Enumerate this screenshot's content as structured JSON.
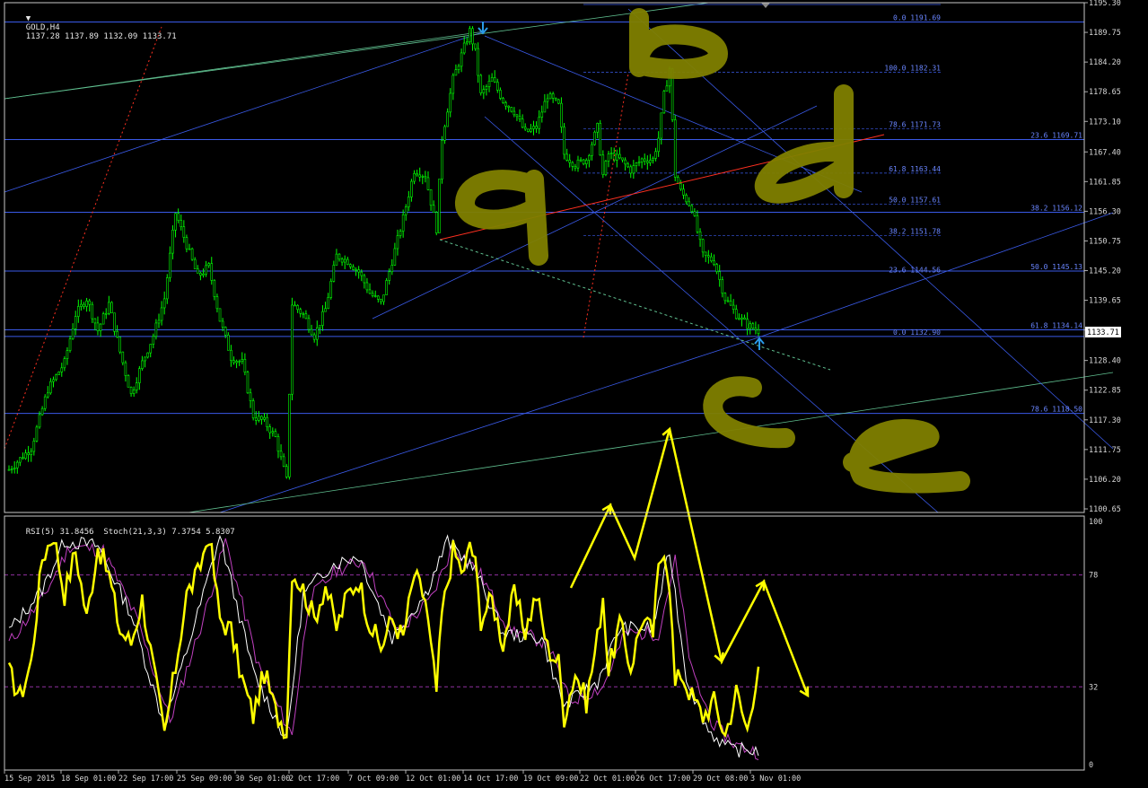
{
  "header": {
    "symbol": "GOLD,H4",
    "ohlc": "1137.28 1137.89 1132.09 1133.71",
    "indicator": "RSI(5) 31.8456  Stoch(21,3,3) 7.3754 5.8307"
  },
  "colors": {
    "background": "#000000",
    "candle": "#00ff00",
    "grid_line": "#3a5ae8",
    "fib_text": "#6a86ff",
    "rsi": "#ffff00",
    "stoch_main": "#ffffff",
    "stoch_signal": "#c040c0",
    "annotation": "#808000",
    "arrow": "#ffff00",
    "green_line": "#60c090",
    "red_line": "#ff3020",
    "marker": "#2a9ae8"
  },
  "chart_data": [
    {
      "type": "candlestick",
      "symbol": "GOLD",
      "timeframe": "H4",
      "ylim": [
        1100.65,
        1195.3
      ],
      "y_ticks": [
        "1195.30",
        "1189.75",
        "1184.20",
        "1178.65",
        "1173.10",
        "1167.40",
        "1161.85",
        "1156.30",
        "1150.75",
        "1145.20",
        "1139.65",
        "1134.10",
        "1128.40",
        "1122.85",
        "1117.30",
        "1111.75",
        "1106.20",
        "1100.65"
      ],
      "current_price": "1133.71",
      "x_ticks": [
        "15 Sep 2015",
        "18 Sep 01:00",
        "22 Sep 17:00",
        "25 Sep 09:00",
        "30 Sep 01:00",
        "2 Oct 17:00",
        "7 Oct 09:00",
        "12 Oct 01:00",
        "14 Oct 17:00",
        "19 Oct 09:00",
        "22 Oct 01:00",
        "26 Oct 17:00",
        "29 Oct 08:00",
        "3 Nov 01:00"
      ],
      "close_path": [
        [
          0,
          1108
        ],
        [
          4,
          1112
        ],
        [
          7,
          1123
        ],
        [
          10,
          1128
        ],
        [
          12,
          1137
        ],
        [
          14,
          1140
        ],
        [
          16,
          1134
        ],
        [
          18,
          1139
        ],
        [
          20,
          1130
        ],
        [
          22,
          1122
        ],
        [
          24,
          1128
        ],
        [
          26,
          1133
        ],
        [
          28,
          1140
        ],
        [
          30,
          1156
        ],
        [
          32,
          1150
        ],
        [
          34,
          1144
        ],
        [
          36,
          1146
        ],
        [
          38,
          1136
        ],
        [
          40,
          1129
        ],
        [
          42,
          1128
        ],
        [
          44,
          1118
        ],
        [
          46,
          1117
        ],
        [
          48,
          1114
        ],
        [
          50,
          1106
        ],
        [
          51,
          1139
        ],
        [
          53,
          1137
        ],
        [
          55,
          1133
        ],
        [
          57,
          1138
        ],
        [
          59,
          1148
        ],
        [
          61,
          1147
        ],
        [
          63,
          1145
        ],
        [
          65,
          1141
        ],
        [
          67,
          1139
        ],
        [
          69,
          1147
        ],
        [
          71,
          1155
        ],
        [
          73,
          1164
        ],
        [
          75,
          1163
        ],
        [
          76,
          1158
        ],
        [
          77,
          1153
        ],
        [
          78,
          1170
        ],
        [
          80,
          1181
        ],
        [
          82,
          1187
        ],
        [
          83,
          1190
        ],
        [
          84,
          1186
        ],
        [
          85,
          1178
        ],
        [
          87,
          1181
        ],
        [
          89,
          1177
        ],
        [
          91,
          1175
        ],
        [
          93,
          1171
        ],
        [
          95,
          1172
        ],
        [
          97,
          1178
        ],
        [
          99,
          1176
        ],
        [
          100,
          1167
        ],
        [
          102,
          1165
        ],
        [
          104,
          1166
        ],
        [
          106,
          1172
        ],
        [
          107,
          1163
        ],
        [
          108,
          1167
        ],
        [
          110,
          1166
        ],
        [
          112,
          1164
        ],
        [
          114,
          1166
        ],
        [
          116,
          1166
        ],
        [
          117,
          1170
        ],
        [
          118,
          1178
        ],
        [
          119,
          1183
        ],
        [
          120,
          1163
        ],
        [
          121,
          1160
        ],
        [
          123,
          1157
        ],
        [
          125,
          1148
        ],
        [
          127,
          1147
        ],
        [
          129,
          1140
        ],
        [
          131,
          1137
        ],
        [
          133,
          1135
        ],
        [
          135,
          1134
        ]
      ],
      "fib_levels_left": [
        {
          "level": "0.0",
          "price": "1191.69"
        },
        {
          "level": "100.0",
          "price": "1182.31"
        },
        {
          "level": "78.6",
          "price": "1171.73"
        },
        {
          "level": "61.8",
          "price": "1163.44"
        },
        {
          "level": "50.0",
          "price": "1157.61"
        },
        {
          "level": "38.2",
          "price": "1151.78"
        },
        {
          "level": "23.6",
          "price": "1144.56"
        },
        {
          "level": "0.0",
          "price": "1132.90"
        }
      ],
      "fib_levels_right": [
        {
          "level": "23.6",
          "price": "1169.71"
        },
        {
          "level": "38.2",
          "price": "1156.12"
        },
        {
          "level": "50.0",
          "price": "1145.13"
        },
        {
          "level": "61.8",
          "price": "1134.14"
        },
        {
          "level": "78.6",
          "price": "1118.50"
        }
      ],
      "annotations": [
        "a",
        "b",
        "d",
        "c",
        "e"
      ]
    },
    {
      "type": "line",
      "title": "RSI(5) 31.8456  Stoch(21,3,3) 7.3754 5.8307",
      "ylim": [
        0,
        100
      ],
      "y_ticks": [
        "100",
        "78",
        "32",
        "0"
      ],
      "levels": [
        78,
        32
      ],
      "rsi_path": [
        [
          0,
          38
        ],
        [
          2,
          28
        ],
        [
          4,
          42
        ],
        [
          6,
          85
        ],
        [
          8,
          95
        ],
        [
          10,
          70
        ],
        [
          12,
          88
        ],
        [
          14,
          60
        ],
        [
          16,
          90
        ],
        [
          18,
          78
        ],
        [
          20,
          55
        ],
        [
          22,
          50
        ],
        [
          24,
          68
        ],
        [
          26,
          40
        ],
        [
          28,
          12
        ],
        [
          30,
          40
        ],
        [
          32,
          70
        ],
        [
          34,
          78
        ],
        [
          36,
          95
        ],
        [
          38,
          60
        ],
        [
          40,
          55
        ],
        [
          42,
          35
        ],
        [
          44,
          20
        ],
        [
          46,
          38
        ],
        [
          48,
          22
        ],
        [
          50,
          14
        ],
        [
          51,
          80
        ],
        [
          53,
          72
        ],
        [
          55,
          60
        ],
        [
          57,
          74
        ],
        [
          59,
          56
        ],
        [
          61,
          70
        ],
        [
          63,
          76
        ],
        [
          65,
          58
        ],
        [
          67,
          48
        ],
        [
          69,
          60
        ],
        [
          71,
          52
        ],
        [
          73,
          78
        ],
        [
          75,
          68
        ],
        [
          76,
          48
        ],
        [
          77,
          30
        ],
        [
          78,
          62
        ],
        [
          80,
          88
        ],
        [
          82,
          78
        ],
        [
          83,
          92
        ],
        [
          84,
          82
        ],
        [
          85,
          60
        ],
        [
          87,
          68
        ],
        [
          89,
          50
        ],
        [
          91,
          70
        ],
        [
          93,
          55
        ],
        [
          95,
          70
        ],
        [
          97,
          48
        ],
        [
          99,
          42
        ],
        [
          100,
          20
        ],
        [
          102,
          38
        ],
        [
          104,
          26
        ],
        [
          106,
          52
        ],
        [
          107,
          70
        ],
        [
          108,
          38
        ],
        [
          110,
          58
        ],
        [
          112,
          40
        ],
        [
          114,
          60
        ],
        [
          116,
          54
        ],
        [
          117,
          80
        ],
        [
          118,
          90
        ],
        [
          119,
          75
        ],
        [
          120,
          32
        ],
        [
          121,
          38
        ],
        [
          123,
          28
        ],
        [
          125,
          20
        ],
        [
          127,
          26
        ],
        [
          129,
          12
        ],
        [
          131,
          30
        ],
        [
          133,
          14
        ],
        [
          135,
          42
        ]
      ],
      "stoch_main_path": [
        [
          0,
          55
        ],
        [
          6,
          72
        ],
        [
          10,
          92
        ],
        [
          16,
          90
        ],
        [
          22,
          62
        ],
        [
          28,
          16
        ],
        [
          34,
          62
        ],
        [
          38,
          94
        ],
        [
          44,
          38
        ],
        [
          50,
          10
        ],
        [
          53,
          70
        ],
        [
          58,
          82
        ],
        [
          63,
          86
        ],
        [
          69,
          52
        ],
        [
          75,
          70
        ],
        [
          79,
          92
        ],
        [
          84,
          80
        ],
        [
          89,
          54
        ],
        [
          96,
          52
        ],
        [
          100,
          24
        ],
        [
          106,
          34
        ],
        [
          110,
          56
        ],
        [
          116,
          56
        ],
        [
          119,
          88
        ],
        [
          122,
          36
        ],
        [
          126,
          14
        ],
        [
          130,
          6
        ],
        [
          135,
          6
        ]
      ],
      "stoch_signal_path": [
        [
          0,
          50
        ],
        [
          6,
          68
        ],
        [
          11,
          90
        ],
        [
          17,
          88
        ],
        [
          23,
          60
        ],
        [
          29,
          18
        ],
        [
          35,
          60
        ],
        [
          39,
          92
        ],
        [
          45,
          40
        ],
        [
          51,
          12
        ],
        [
          54,
          68
        ],
        [
          59,
          80
        ],
        [
          64,
          84
        ],
        [
          70,
          54
        ],
        [
          76,
          68
        ],
        [
          80,
          90
        ],
        [
          85,
          78
        ],
        [
          90,
          56
        ],
        [
          97,
          50
        ],
        [
          101,
          26
        ],
        [
          107,
          32
        ],
        [
          111,
          54
        ],
        [
          117,
          54
        ],
        [
          120,
          84
        ],
        [
          123,
          38
        ],
        [
          127,
          16
        ],
        [
          131,
          8
        ],
        [
          135,
          5
        ]
      ]
    }
  ]
}
